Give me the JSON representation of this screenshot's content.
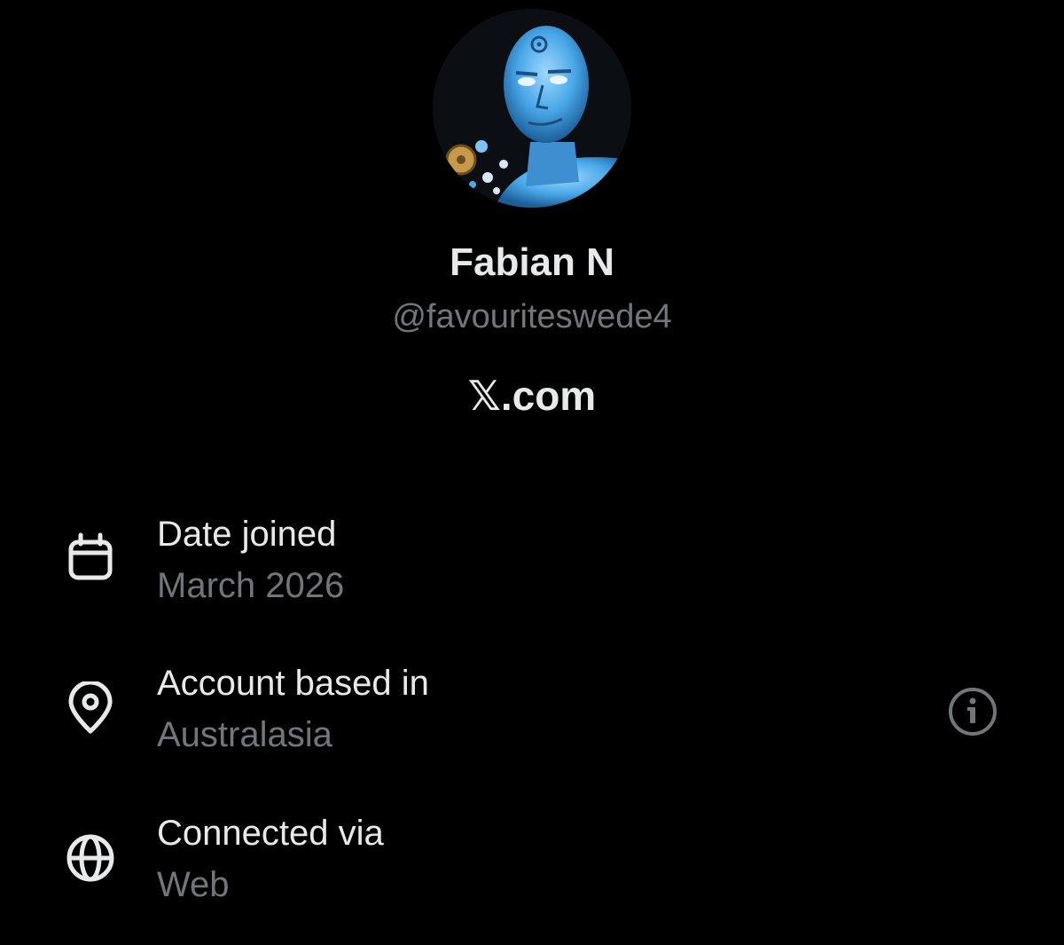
{
  "profile": {
    "display_name": "Fabian N",
    "handle": "@favouriteswede4",
    "platform": "𝕏.com",
    "avatar_icon": "avatar-blue-figure"
  },
  "about": {
    "rows": [
      {
        "label": "Date joined",
        "value": "March 2026",
        "icon": "calendar-icon"
      },
      {
        "label": "Account based in",
        "value": "Australasia",
        "icon": "location-pin-icon",
        "has_info": true
      },
      {
        "label": "Connected via",
        "value": "Web",
        "icon": "globe-icon"
      }
    ]
  },
  "colors": {
    "background": "#000000",
    "primary_text": "#e7e9ea",
    "secondary_text": "#71767b",
    "avatar_accent": "#4aa8e8"
  }
}
